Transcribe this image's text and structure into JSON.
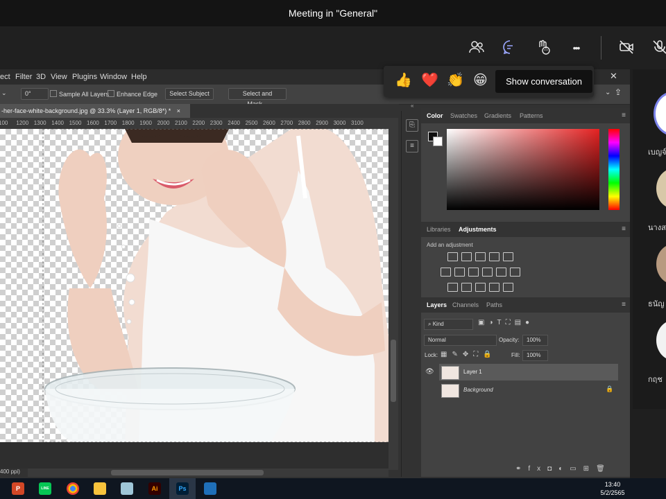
{
  "teams": {
    "meeting_title": "Meeting in \"General\"",
    "toolbar": {
      "participants_icon": "people-icon",
      "chat_icon": "chat-icon",
      "reactions_icon": "raise-hand-icon",
      "more_icon": "more-icon",
      "more_label": "•••",
      "camera_icon": "camera-off-icon",
      "mic_icon": "mic-off-icon"
    },
    "reactions": [
      "👍",
      "❤️",
      "👏",
      "😁"
    ],
    "tooltip": "Show conversation",
    "participants": [
      {
        "name": "เบญจ์"
      },
      {
        "name": "นางส"
      },
      {
        "name": "ธนัญ"
      },
      {
        "name": "กฤช"
      }
    ]
  },
  "photoshop": {
    "menu": [
      "ect",
      "Filter",
      "3D",
      "View",
      "Plugins",
      "Window",
      "Help"
    ],
    "options": {
      "angle_value": "0°",
      "sample_all_layers": "Sample All Layers",
      "enhance_edge": "Enhance Edge",
      "select_subject": "Select Subject",
      "select_and_mask": "Select and Mask..."
    },
    "document_tab": "-her-face-white-background.jpg @ 33.3% (Layer 1, RGB/8*) *",
    "document_tab_close": "×",
    "ruler_ticks": [
      "100",
      "1200",
      "1300",
      "1400",
      "1500",
      "1600",
      "1700",
      "1800",
      "1900",
      "2000",
      "2100",
      "2200",
      "2300",
      "2400",
      "2500",
      "2600",
      "2700",
      "2800",
      "2900",
      "3000",
      "3100"
    ],
    "status_text": "400 ppi)",
    "color_panel": {
      "tabs": [
        "Color",
        "Swatches",
        "Gradients",
        "Patterns"
      ],
      "active_tab": "Color",
      "hue_color": "#e52222"
    },
    "adjustments_panel": {
      "tabs": [
        "Libraries",
        "Adjustments"
      ],
      "active_tab": "Adjustments",
      "hint": "Add an adjustment"
    },
    "layers_panel": {
      "tabs": [
        "Layers",
        "Channels",
        "Paths"
      ],
      "active_tab": "Layers",
      "filter_kind": "Kind",
      "blend_mode": "Normal",
      "opacity_label": "Opacity:",
      "opacity_value": "100%",
      "lock_label": "Lock:",
      "fill_label": "Fill:",
      "fill_value": "100%",
      "layers": [
        {
          "name": "Layer 1",
          "visible": true,
          "selected": true
        },
        {
          "name": "Background",
          "visible": false,
          "selected": false,
          "locked": true
        }
      ]
    }
  },
  "taskbar": {
    "apps": [
      "powerpoint-icon",
      "line-icon",
      "chrome-icon",
      "file-explorer-icon",
      "app-icon",
      "illustrator-icon",
      "photoshop-icon",
      "photos-icon"
    ],
    "app_labels": {
      "powerpoint": "P",
      "line": "LINE",
      "illustrator": "Ai",
      "photoshop": "Ps"
    },
    "time": "13:40",
    "date": "5/2/2565"
  }
}
